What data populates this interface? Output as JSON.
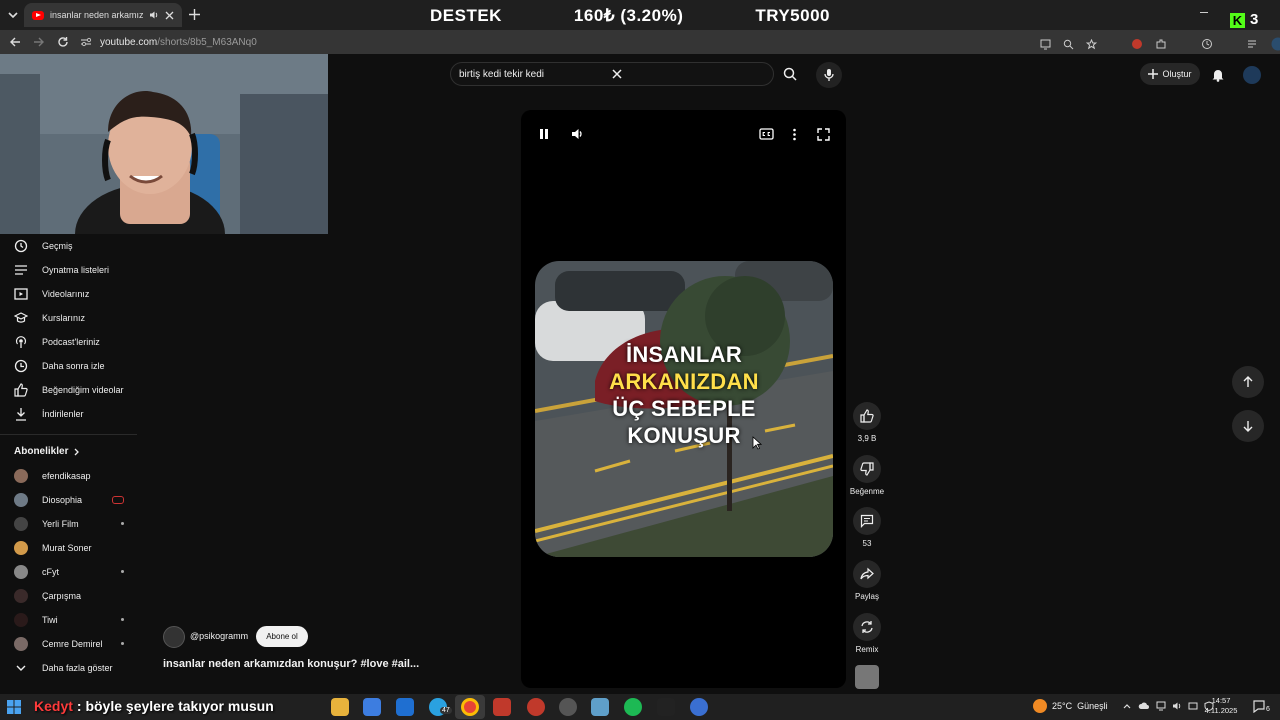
{
  "browser": {
    "tab_title": "insanlar neden arkamızdan",
    "url_host": "youtube.com",
    "url_path": "/shorts/8b5_M63ANq0"
  },
  "overlay": {
    "ticker_left": "DESTEK",
    "ticker_mid": "160₺ (3.20%)",
    "ticker_right": "TRY5000",
    "badge": "3"
  },
  "youtube": {
    "search_value": "birtiş kedi tekir kedi",
    "create_label": "Oluştur",
    "sidebar": {
      "items": [
        {
          "label": "Geçmiş",
          "icon": "history-icon"
        },
        {
          "label": "Oynatma listeleri",
          "icon": "playlist-icon"
        },
        {
          "label": "Videolarınız",
          "icon": "your-videos-icon"
        },
        {
          "label": "Kurslarınız",
          "icon": "courses-icon"
        },
        {
          "label": "Podcast'leriniz",
          "icon": "podcast-icon"
        },
        {
          "label": "Daha sonra izle",
          "icon": "clock-icon"
        },
        {
          "label": "Beğendiğim videolar",
          "icon": "thumbs-up-icon"
        },
        {
          "label": "İndirilenler",
          "icon": "download-icon"
        }
      ],
      "subscriptions_title": "Abonelikler",
      "subscriptions": [
        {
          "name": "efendikasap",
          "color": "#8a6a5a"
        },
        {
          "name": "Diosophia",
          "color": "#6e7a86"
        },
        {
          "name": "Yerli Film",
          "color": "#444444"
        },
        {
          "name": "Murat Soner",
          "color": "#d29a4a"
        },
        {
          "name": "cFyt",
          "color": "#888888"
        },
        {
          "name": "Çarpışma",
          "color": "#3a2a2a"
        },
        {
          "name": "Tiwi",
          "color": "#2a1a1a"
        },
        {
          "name": "Cemre Demirel",
          "color": "#7a6a66"
        }
      ],
      "show_more": "Daha fazla göster"
    },
    "short": {
      "caption_lines": [
        "İNSANLAR",
        "ARKANIZDAN",
        "ÜÇ SEBEPLE",
        "KONUŞUR"
      ],
      "channel": "@psikogramm",
      "subscribe_label": "Abone ol",
      "title": "insanlar neden arkamızdan konuşur? #love #ail..."
    },
    "actions": {
      "like_count": "3,9 B",
      "dislike_label": "Beğenme",
      "comment_count": "53",
      "share_label": "Paylaş",
      "remix_label": "Remix"
    }
  },
  "chat_overlay": {
    "user": "Kedyt",
    "message": ": böyle şeylere takıyor musun"
  },
  "taskbar": {
    "weather": "25°C  Güneşli",
    "time": "14:57",
    "date": "4.11.2025",
    "notif_count": "6",
    "telegram_badge": "47"
  },
  "colors": {
    "background": "#0f0f0f",
    "youtube_red": "#ff0000",
    "caption_yellow": "#ffdf4a"
  }
}
